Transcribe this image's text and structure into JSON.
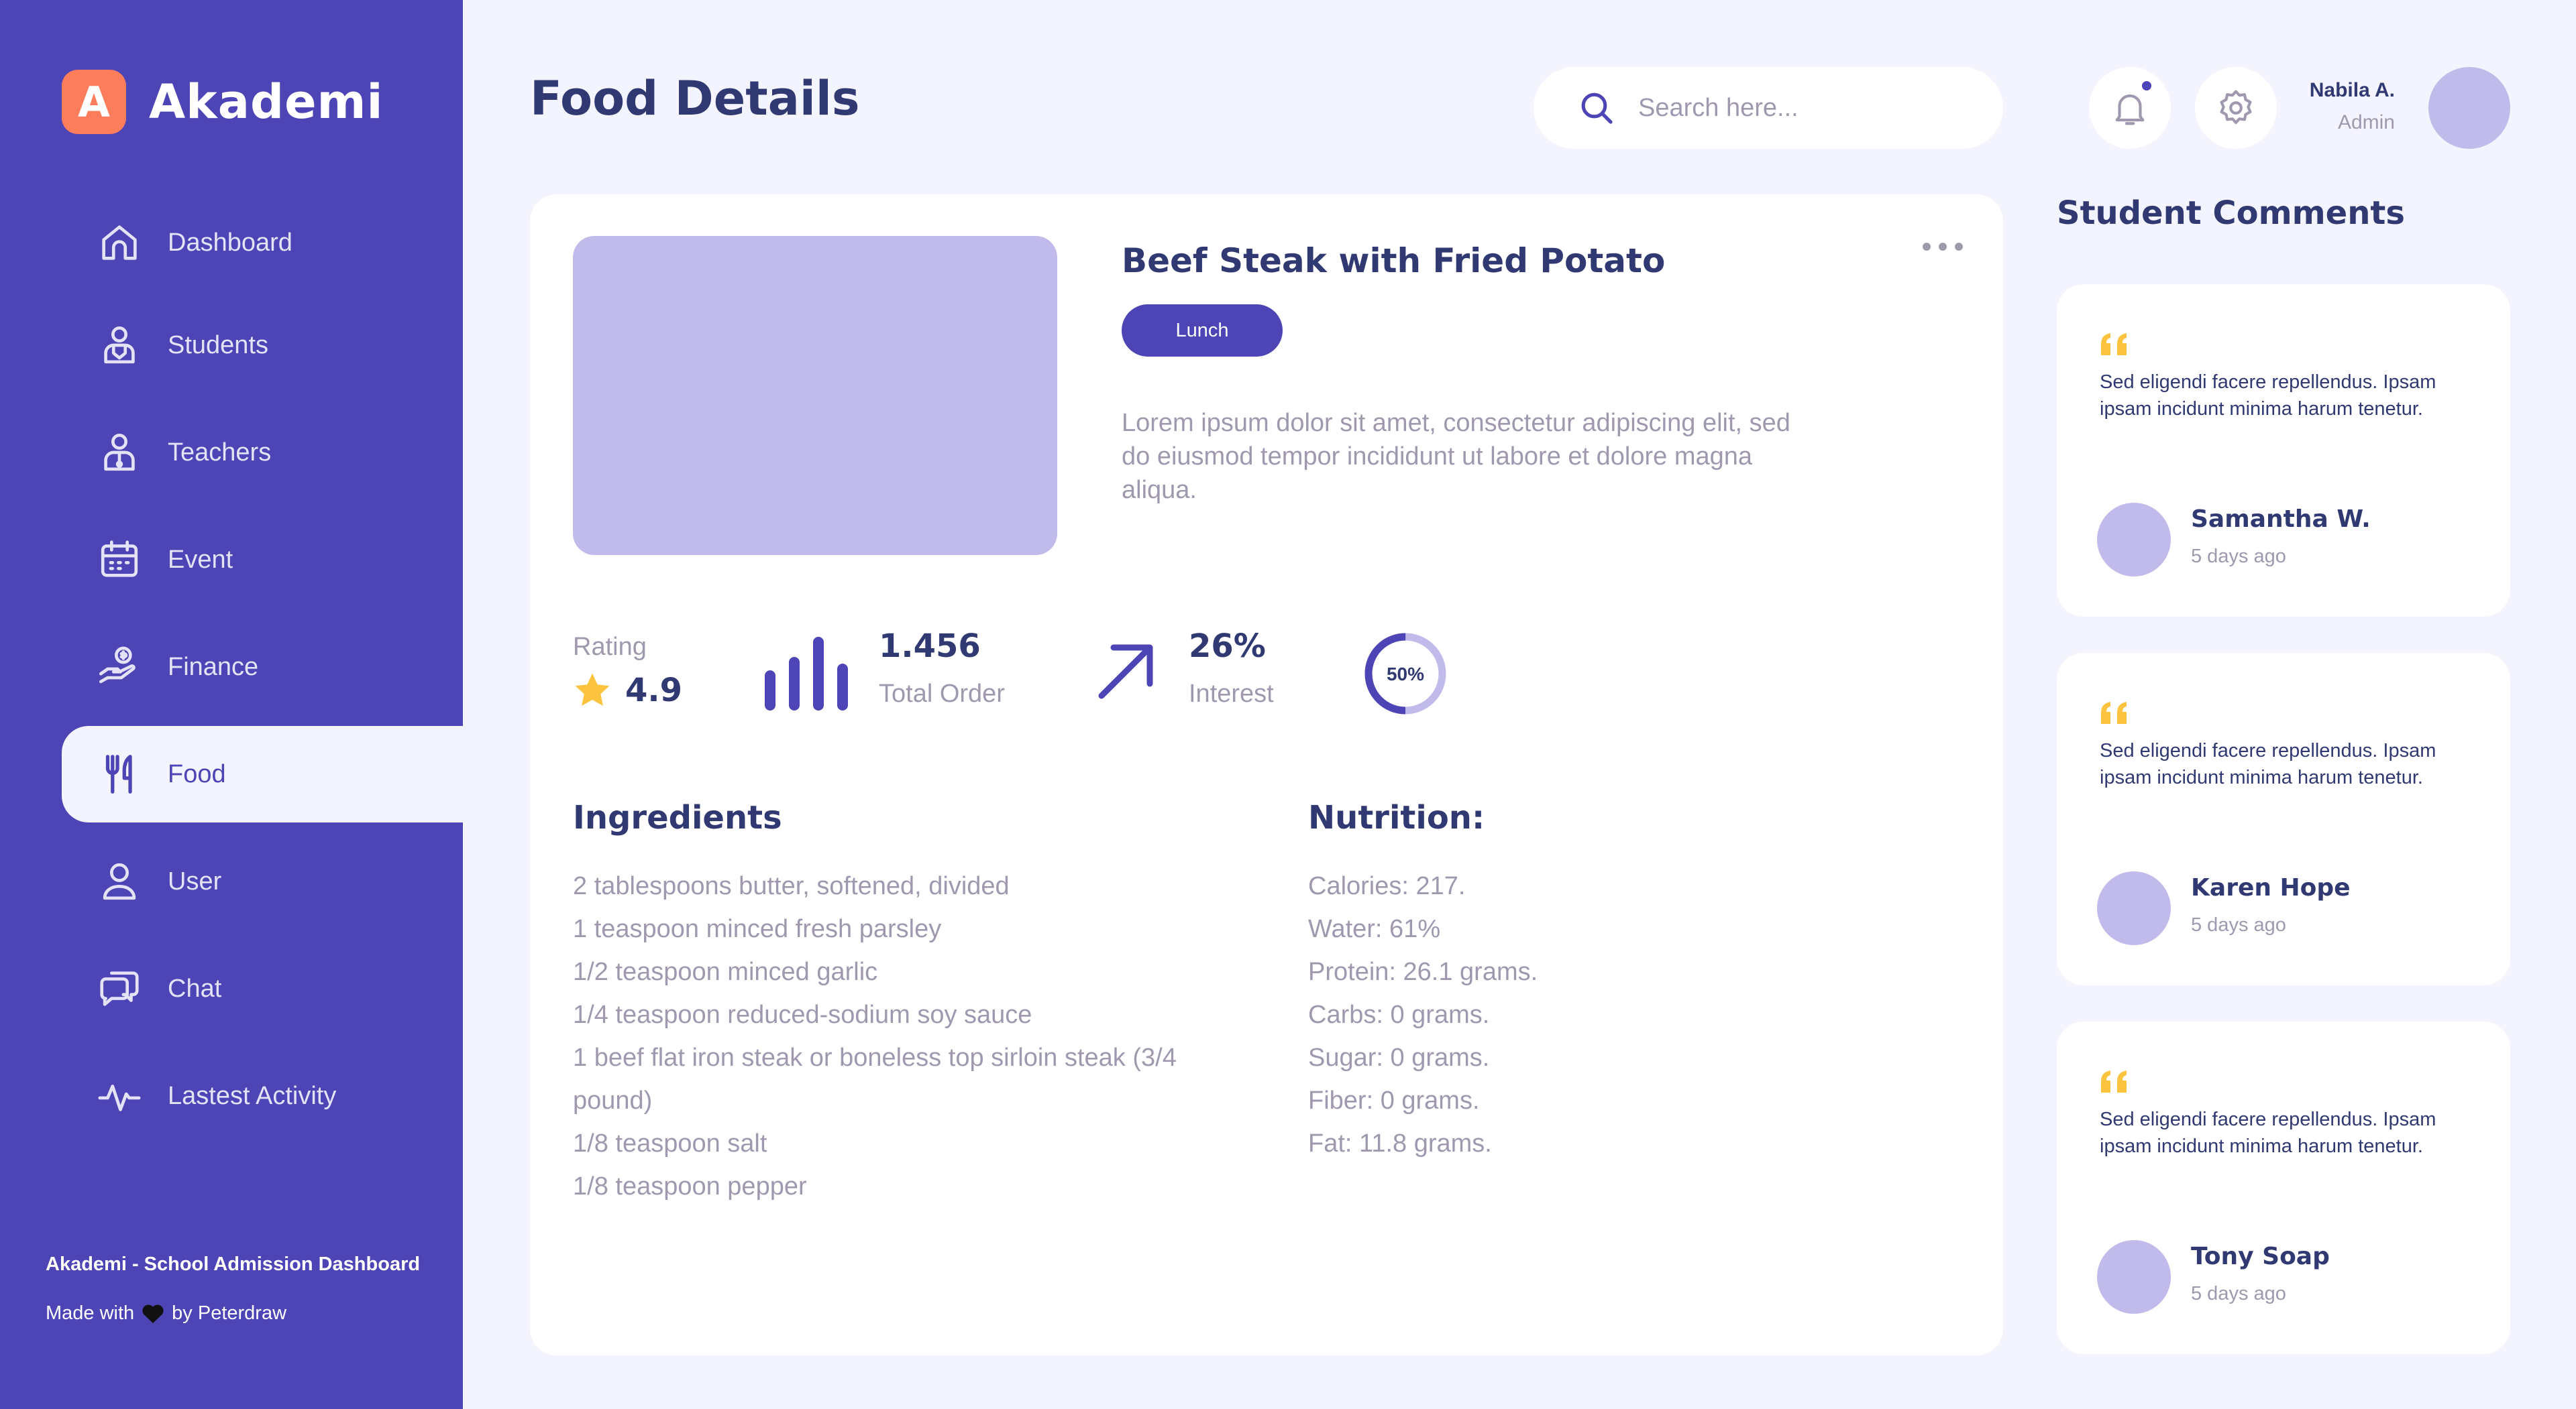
{
  "brand": {
    "logo_letter": "A",
    "name": "Akademi"
  },
  "sidebar": {
    "items": [
      {
        "label": "Dashboard",
        "icon": "home-icon",
        "active": false
      },
      {
        "label": "Students",
        "icon": "student-icon",
        "active": false
      },
      {
        "label": "Teachers",
        "icon": "teacher-icon",
        "active": false
      },
      {
        "label": "Event",
        "icon": "calendar-icon",
        "active": false
      },
      {
        "label": "Finance",
        "icon": "finance-icon",
        "active": false
      },
      {
        "label": "Food",
        "icon": "food-icon",
        "active": true
      },
      {
        "label": "User",
        "icon": "user-icon",
        "active": false
      },
      {
        "label": "Chat",
        "icon": "chat-icon",
        "active": false
      },
      {
        "label": "Lastest Activity",
        "icon": "activity-icon",
        "active": false
      }
    ],
    "footer_title": "Akademi - School Admission Dashboard",
    "footer_made_prefix": "Made with",
    "footer_made_suffix": "by Peterdraw"
  },
  "header": {
    "title": "Food Details",
    "search_placeholder": "Search here...",
    "user_name": "Nabila A.",
    "user_role": "Admin",
    "notification_dot": true
  },
  "food": {
    "name": "Beef Steak with Fried Potato",
    "tag": "Lunch",
    "description": "Lorem ipsum dolor sit amet, consectetur adipiscing elit, sed do eiusmod tempor incididunt ut labore et dolore magna aliqua.",
    "rating_label": "Rating",
    "rating_value": "4.9",
    "total_order_value": "1.456",
    "total_order_label": "Total Order",
    "interest_value": "26%",
    "interest_label": "Interest",
    "progress_text": "50%",
    "progress_fraction": 0.5
  },
  "ingredients": {
    "title": "Ingredients",
    "items": [
      "2 tablespoons butter, softened, divided",
      "1 teaspoon minced fresh parsley",
      "1/2 teaspoon minced garlic",
      "1/4 teaspoon reduced-sodium soy sauce",
      "1 beef flat iron steak or boneless top sirloin steak (3/4 pound)",
      "1/8 teaspoon salt",
      "1/8 teaspoon pepper"
    ]
  },
  "nutrition": {
    "title": "Nutrition:",
    "items": [
      "Calories: 217.",
      "Water: 61%",
      "Protein: 26.1 grams.",
      "Carbs: 0 grams.",
      "Sugar: 0 grams.",
      "Fiber: 0 grams.",
      "Fat: 11.8 grams."
    ]
  },
  "comments": {
    "title": "Student Comments",
    "items": [
      {
        "text": "Sed eligendi facere repellendus. Ipsam ipsam incidunt minima harum tenetur.",
        "name": "Samantha W.",
        "time": "5 days ago"
      },
      {
        "text": "Sed eligendi facere repellendus. Ipsam ipsam incidunt minima harum tenetur.",
        "name": "Karen Hope",
        "time": "5 days ago"
      },
      {
        "text": "Sed eligendi facere repellendus. Ipsam ipsam incidunt minima harum tenetur.",
        "name": "Tony Soap",
        "time": "5 days ago"
      }
    ]
  },
  "colors": {
    "primary": "#4D44B5",
    "accent_orange": "#FB7D5B",
    "star_yellow": "#FCC43E",
    "text_dark": "#303972",
    "text_muted": "#A098AE",
    "placeholder_lavender": "#C1BBEB",
    "background": "#F3F4FD"
  }
}
